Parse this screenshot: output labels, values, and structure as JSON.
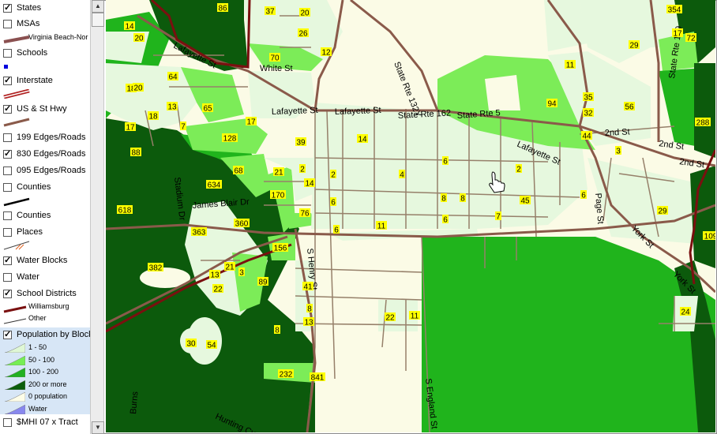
{
  "legend": {
    "layers": [
      {
        "label": "States",
        "checked": true
      },
      {
        "label": "MSAs",
        "checked": false
      },
      {
        "label": "Schools",
        "checked": false
      },
      {
        "label": "Interstate",
        "checked": true
      },
      {
        "label": "US & St Hwy",
        "checked": true
      },
      {
        "label": "199 Edges/Roads",
        "checked": false
      },
      {
        "label": "830 Edges/Roads",
        "checked": true
      },
      {
        "label": "095 Edges/Roads",
        "checked": false
      },
      {
        "label": "Counties",
        "checked": false
      },
      {
        "label": "Counties",
        "checked": false
      },
      {
        "label": "Places",
        "checked": false
      },
      {
        "label": "Water Blocks",
        "checked": true
      },
      {
        "label": "Water",
        "checked": false
      },
      {
        "label": "School Districts",
        "checked": true
      },
      {
        "label": "Population by Block",
        "checked": true
      },
      {
        "label": "$MHI 07 x Tract",
        "checked": false
      }
    ],
    "msa_sub": "Virginia Beach-Nor",
    "school_district_subs": [
      "Williamsburg",
      "Other"
    ],
    "population_classes": [
      {
        "label": "1 - 50",
        "color": "#dff7d5"
      },
      {
        "label": "50 - 100",
        "color": "#76ee55"
      },
      {
        "label": "100 - 200",
        "color": "#22b022"
      },
      {
        "label": "200 or more",
        "color": "#0b5e0b"
      },
      {
        "label": "0 population",
        "color": "#fdfde8"
      },
      {
        "label": "Water",
        "color": "#8888ee"
      }
    ]
  },
  "colors": {
    "cls1": "#e6f8de",
    "cls2": "#7cec58",
    "cls3": "#20b41c",
    "cls4": "#0c5a0c",
    "cls0": "#fbfbe6",
    "road": "#96806a",
    "hwy": "#8a5a4a",
    "district": "#7a1010",
    "label_bg": "#ffff00"
  },
  "map": {
    "street_labels": [
      "Lafayette St",
      "Lafayette St",
      "Lafayette St",
      "Lafayette St",
      "White St",
      "State Rte 132Y",
      "State Rte 162",
      "State Rte 5",
      "2nd St",
      "2nd St",
      "2nd St",
      "State Rte 199",
      "Stadium Dr",
      "James Blair Dr",
      "S Henry St",
      "Page St",
      "York St",
      "York St",
      "S England St",
      "Burns",
      "Hunting Cv"
    ],
    "block_labels": [
      "86",
      "37",
      "20",
      "26",
      "12",
      "70",
      "14",
      "20",
      "18",
      "11",
      "29",
      "354",
      "17",
      "72",
      "64",
      "20",
      "13",
      "65",
      "17",
      "18",
      "7",
      "17",
      "39",
      "14",
      "94",
      "35",
      "56",
      "32",
      "44",
      "3",
      "288",
      "128",
      "88",
      "68",
      "21",
      "2",
      "2",
      "4",
      "6",
      "2",
      "634",
      "14",
      "170",
      "6",
      "8",
      "8",
      "45",
      "6",
      "29",
      "618",
      "76",
      "6",
      "11",
      "7",
      "6",
      "363",
      "360",
      "156",
      "109",
      "382",
      "21",
      "13",
      "3",
      "89",
      "22",
      "41",
      "8",
      "13",
      "8",
      "22",
      "11",
      "24",
      "30",
      "54",
      "232",
      "841"
    ]
  }
}
